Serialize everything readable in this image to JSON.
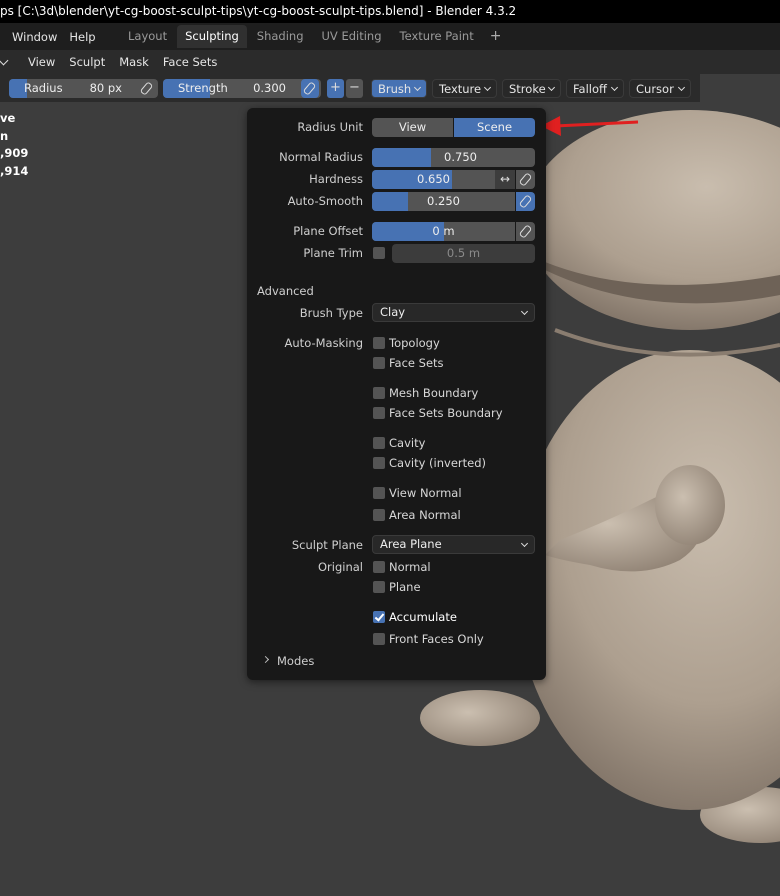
{
  "window": {
    "title": "ps [C:\\3d\\blender\\yt-cg-boost-sculpt-tips\\yt-cg-boost-sculpt-tips.blend] - Blender 4.3.2"
  },
  "menubar": {
    "items": [
      "Window",
      "Help"
    ],
    "workspace_tabs": [
      "Layout",
      "Sculpting",
      "Shading",
      "UV Editing",
      "Texture Paint"
    ],
    "active_tab": "Sculpting",
    "add_tab": "+"
  },
  "header": {
    "items": [
      "View",
      "Sculpt",
      "Mask",
      "Face Sets"
    ]
  },
  "toolbar": {
    "radius_label": "Radius",
    "radius_value": "80 px",
    "strength_label": "Strength",
    "strength_value": "0.300",
    "strength_fraction": 0.3,
    "plus": "+",
    "minus": "−",
    "dropdowns": [
      "Brush",
      "Texture",
      "Stroke",
      "Falloff",
      "Cursor"
    ],
    "active_dropdown": "Brush"
  },
  "stats": [
    "ve",
    "n",
    ",909",
    ",914"
  ],
  "popup": {
    "radius_unit_label": "Radius Unit",
    "radius_unit_options": [
      "View",
      "Scene"
    ],
    "radius_unit_selected": "Scene",
    "normal_radius_label": "Normal Radius",
    "normal_radius_value": "0.750",
    "normal_radius_fraction": 0.36,
    "hardness_label": "Hardness",
    "hardness_value": "0.650",
    "hardness_fraction": 0.65,
    "auto_smooth_label": "Auto-Smooth",
    "auto_smooth_value": "0.250",
    "auto_smooth_fraction": 0.25,
    "plane_offset_label": "Plane Offset",
    "plane_offset_value": "0 m",
    "plane_offset_fraction": 0.5,
    "plane_trim_label": "Plane Trim",
    "plane_trim_value": "0.5 m",
    "advanced_label": "Advanced",
    "brush_type_label": "Brush Type",
    "brush_type_value": "Clay",
    "auto_masking_label": "Auto-Masking",
    "masking_options": [
      {
        "label": "Topology",
        "checked": false
      },
      {
        "label": "Face Sets",
        "checked": false
      },
      {
        "label": "Mesh Boundary",
        "checked": false
      },
      {
        "label": "Face Sets Boundary",
        "checked": false
      },
      {
        "label": "Cavity",
        "checked": false
      },
      {
        "label": "Cavity (inverted)",
        "checked": false
      },
      {
        "label": "View Normal",
        "checked": false
      },
      {
        "label": "Area Normal",
        "checked": false
      }
    ],
    "sculpt_plane_label": "Sculpt Plane",
    "sculpt_plane_value": "Area Plane",
    "original_label": "Original",
    "original_options": [
      {
        "label": "Normal",
        "checked": false
      },
      {
        "label": "Plane",
        "checked": false
      }
    ],
    "accumulate_label": "Accumulate",
    "accumulate_checked": true,
    "front_faces_label": "Front Faces Only",
    "front_faces_checked": false,
    "modes_label": "Modes"
  },
  "colors": {
    "accent": "#4772b3",
    "annotation": "#e02020",
    "model": "#b3a797"
  }
}
